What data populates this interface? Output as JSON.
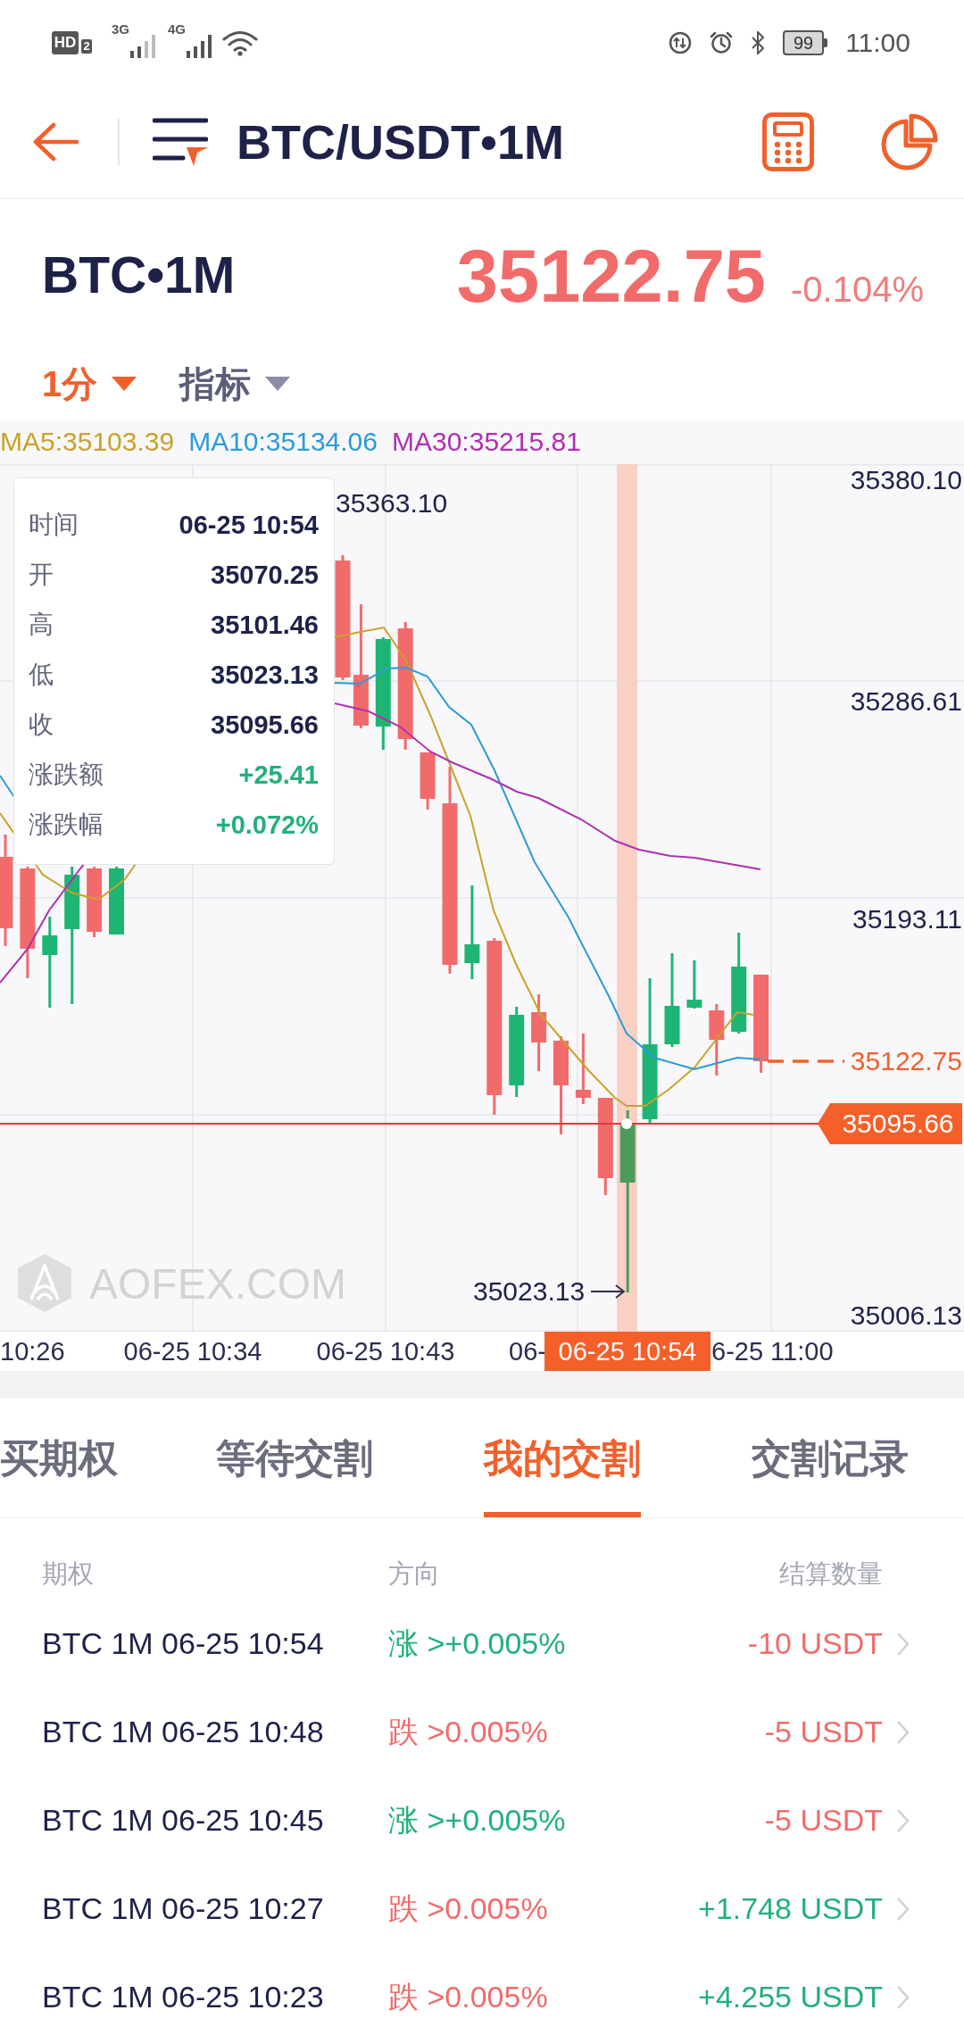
{
  "status_bar": {
    "hd": "HD",
    "hd_sim": "2",
    "network_1": "3G",
    "network_2": "4G",
    "battery": "99",
    "time": "11:00"
  },
  "header": {
    "title": "BTC/USDT•1M"
  },
  "ticker": {
    "symbol": "BTC•1M",
    "price": "35122.75",
    "change": "-0.104%"
  },
  "selectors": [
    {
      "label": "1分",
      "selected": true
    },
    {
      "label": "指标",
      "selected": false
    }
  ],
  "chart": {
    "legend": [
      {
        "text": "MA5:35103.39",
        "color": "#c9a227"
      },
      {
        "text": "MA10:35134.06",
        "color": "#2b9bd8"
      },
      {
        "text": "MA30:35215.81",
        "color": "#b02fb0"
      }
    ],
    "y_labels": [
      "35380.10",
      "35286.61",
      "35193.11",
      "35006.13"
    ],
    "high_label": "35363.10",
    "low_label": "35023.13",
    "last_price": "35122.75",
    "crosshair_price": "35095.66",
    "logo": "AOFEX.COM",
    "tooltip": [
      {
        "label": "时间",
        "value": "06-25 10:54",
        "color": "#1e2148"
      },
      {
        "label": "开",
        "value": "35070.25",
        "color": "#1e2148"
      },
      {
        "label": "高",
        "value": "35101.46",
        "color": "#1e2148"
      },
      {
        "label": "低",
        "value": "35023.13",
        "color": "#1e2148"
      },
      {
        "label": "收",
        "value": "35095.66",
        "color": "#1e2148"
      },
      {
        "label": "涨跌额",
        "value": "+25.41",
        "color": "#22b07a"
      },
      {
        "label": "涨跌幅",
        "value": "+0.072%",
        "color": "#22b07a"
      }
    ],
    "x_labels": [
      "10:26",
      "06-25 10:34",
      "06-25 10:43",
      "06-",
      "6-25 11:00"
    ],
    "crosshair_time": "06-25 10:54"
  },
  "tabs": [
    {
      "label": "买期权",
      "selected": false
    },
    {
      "label": "等待交割",
      "selected": false
    },
    {
      "label": "我的交割",
      "selected": true
    },
    {
      "label": "交割记录",
      "selected": false
    }
  ],
  "table": {
    "columns": [
      "期权",
      "方向",
      "结算数量"
    ],
    "rows": [
      {
        "option": "BTC 1M 06-25 10:54",
        "direction": {
          "text": "涨 >+0.005%",
          "color": "#22b07a"
        },
        "amount": {
          "text": "-10 USDT",
          "color": "#f06c6c"
        }
      },
      {
        "option": "BTC 1M 06-25 10:48",
        "direction": {
          "text": "跌 >0.005%",
          "color": "#f06c6c"
        },
        "amount": {
          "text": "-5 USDT",
          "color": "#f06c6c"
        }
      },
      {
        "option": "BTC 1M 06-25 10:45",
        "direction": {
          "text": "涨 >+0.005%",
          "color": "#22b07a"
        },
        "amount": {
          "text": "-5 USDT",
          "color": "#f06c6c"
        }
      },
      {
        "option": "BTC 1M 06-25 10:27",
        "direction": {
          "text": "跌 >0.005%",
          "color": "#f06c6c"
        },
        "amount": {
          "text": "+1.748 USDT",
          "color": "#22b07a"
        }
      },
      {
        "option": "BTC 1M 06-25 10:23",
        "direction": {
          "text": "跌 >0.005%",
          "color": "#f06c6c"
        },
        "amount": {
          "text": "+4.255 USDT",
          "color": "#22b07a"
        }
      }
    ]
  }
}
